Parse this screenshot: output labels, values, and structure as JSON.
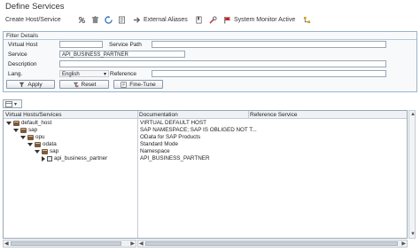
{
  "window_title": "Define Services",
  "toolbar": {
    "create_label": "Create Host/Service",
    "external_aliases_label": "External Aliases",
    "system_monitor_label": "System Monitor Active"
  },
  "filter": {
    "section_title": "Filter Details",
    "virtual_host_label": "Virtual Host",
    "virtual_host_value": "",
    "service_path_label": "Service Path",
    "service_path_value": "",
    "service_label": "Service",
    "service_value": "API_BUSINESS_PARTNER",
    "description_label": "Description",
    "description_value": "",
    "lang_label": "Lang.",
    "lang_value": "English",
    "reference_label": "Reference",
    "reference_value": "",
    "apply_label": "Apply",
    "reset_label": "Reset",
    "finetune_label": "Fine-Tune"
  },
  "tree": {
    "col_hosts": "Virtual Hosts/Services",
    "col_doc": "Documentation",
    "col_ref": "Reference Service",
    "rows": [
      {
        "label": "default_host",
        "doc": "VIRTUAL DEFAULT HOST"
      },
      {
        "label": "sap",
        "doc": "SAP NAMESPACE; SAP IS OBLIGED NOT T..."
      },
      {
        "label": "opu",
        "doc": "OData for SAP Products"
      },
      {
        "label": "odata",
        "doc": "Standard Mode"
      },
      {
        "label": "sap",
        "doc": "Namespace"
      },
      {
        "label": "api_business_partner",
        "doc": "API_BUSINESS_PARTNER"
      }
    ]
  },
  "colors": {
    "panel_border": "#9bb3cc",
    "panel_bg": "#f7f9fb",
    "folder": "#7c5a3a",
    "flag_red": "#c0282d"
  }
}
